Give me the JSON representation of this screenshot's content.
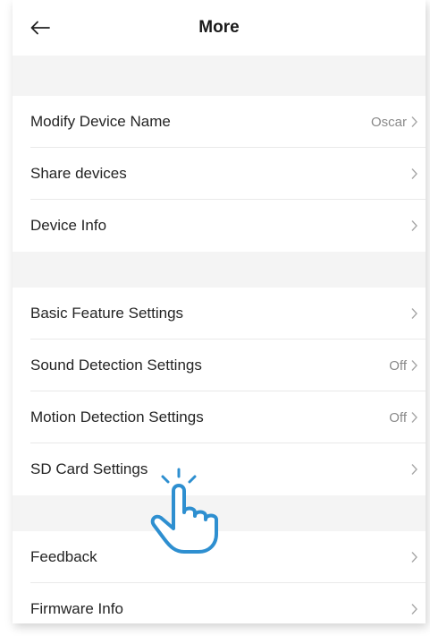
{
  "header": {
    "title": "More"
  },
  "sections": [
    {
      "rows": [
        {
          "label": "Modify Device Name",
          "value": "Oscar"
        },
        {
          "label": "Share devices",
          "value": ""
        },
        {
          "label": "Device Info",
          "value": ""
        }
      ]
    },
    {
      "rows": [
        {
          "label": "Basic Feature Settings",
          "value": ""
        },
        {
          "label": "Sound Detection Settings",
          "value": "Off"
        },
        {
          "label": "Motion Detection Settings",
          "value": "Off"
        },
        {
          "label": "SD Card Settings",
          "value": ""
        }
      ]
    },
    {
      "rows": [
        {
          "label": "Feedback",
          "value": ""
        },
        {
          "label": "Firmware Info",
          "value": ""
        }
      ]
    }
  ],
  "icons": {
    "back": "arrow-left-icon",
    "chevron": "chevron-right-icon",
    "pointer": "hand-pointer-icon"
  },
  "colors": {
    "section_gap": "#f4f4f4",
    "value_text": "#8a8a8a",
    "pointer_stroke": "#2e8fd0"
  }
}
